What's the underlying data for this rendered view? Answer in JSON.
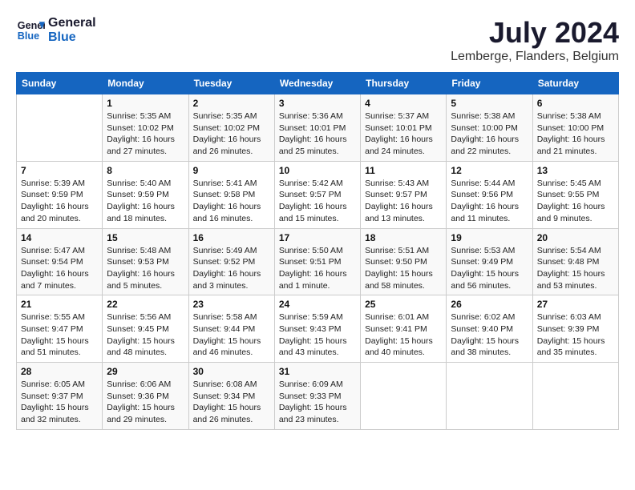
{
  "header": {
    "logo_line1": "General",
    "logo_line2": "Blue",
    "month_year": "July 2024",
    "location": "Lemberge, Flanders, Belgium"
  },
  "weekdays": [
    "Sunday",
    "Monday",
    "Tuesday",
    "Wednesday",
    "Thursday",
    "Friday",
    "Saturday"
  ],
  "weeks": [
    [
      {
        "day": "",
        "info": ""
      },
      {
        "day": "1",
        "info": "Sunrise: 5:35 AM\nSunset: 10:02 PM\nDaylight: 16 hours\nand 27 minutes."
      },
      {
        "day": "2",
        "info": "Sunrise: 5:35 AM\nSunset: 10:02 PM\nDaylight: 16 hours\nand 26 minutes."
      },
      {
        "day": "3",
        "info": "Sunrise: 5:36 AM\nSunset: 10:01 PM\nDaylight: 16 hours\nand 25 minutes."
      },
      {
        "day": "4",
        "info": "Sunrise: 5:37 AM\nSunset: 10:01 PM\nDaylight: 16 hours\nand 24 minutes."
      },
      {
        "day": "5",
        "info": "Sunrise: 5:38 AM\nSunset: 10:00 PM\nDaylight: 16 hours\nand 22 minutes."
      },
      {
        "day": "6",
        "info": "Sunrise: 5:38 AM\nSunset: 10:00 PM\nDaylight: 16 hours\nand 21 minutes."
      }
    ],
    [
      {
        "day": "7",
        "info": "Sunrise: 5:39 AM\nSunset: 9:59 PM\nDaylight: 16 hours\nand 20 minutes."
      },
      {
        "day": "8",
        "info": "Sunrise: 5:40 AM\nSunset: 9:59 PM\nDaylight: 16 hours\nand 18 minutes."
      },
      {
        "day": "9",
        "info": "Sunrise: 5:41 AM\nSunset: 9:58 PM\nDaylight: 16 hours\nand 16 minutes."
      },
      {
        "day": "10",
        "info": "Sunrise: 5:42 AM\nSunset: 9:57 PM\nDaylight: 16 hours\nand 15 minutes."
      },
      {
        "day": "11",
        "info": "Sunrise: 5:43 AM\nSunset: 9:57 PM\nDaylight: 16 hours\nand 13 minutes."
      },
      {
        "day": "12",
        "info": "Sunrise: 5:44 AM\nSunset: 9:56 PM\nDaylight: 16 hours\nand 11 minutes."
      },
      {
        "day": "13",
        "info": "Sunrise: 5:45 AM\nSunset: 9:55 PM\nDaylight: 16 hours\nand 9 minutes."
      }
    ],
    [
      {
        "day": "14",
        "info": "Sunrise: 5:47 AM\nSunset: 9:54 PM\nDaylight: 16 hours\nand 7 minutes."
      },
      {
        "day": "15",
        "info": "Sunrise: 5:48 AM\nSunset: 9:53 PM\nDaylight: 16 hours\nand 5 minutes."
      },
      {
        "day": "16",
        "info": "Sunrise: 5:49 AM\nSunset: 9:52 PM\nDaylight: 16 hours\nand 3 minutes."
      },
      {
        "day": "17",
        "info": "Sunrise: 5:50 AM\nSunset: 9:51 PM\nDaylight: 16 hours\nand 1 minute."
      },
      {
        "day": "18",
        "info": "Sunrise: 5:51 AM\nSunset: 9:50 PM\nDaylight: 15 hours\nand 58 minutes."
      },
      {
        "day": "19",
        "info": "Sunrise: 5:53 AM\nSunset: 9:49 PM\nDaylight: 15 hours\nand 56 minutes."
      },
      {
        "day": "20",
        "info": "Sunrise: 5:54 AM\nSunset: 9:48 PM\nDaylight: 15 hours\nand 53 minutes."
      }
    ],
    [
      {
        "day": "21",
        "info": "Sunrise: 5:55 AM\nSunset: 9:47 PM\nDaylight: 15 hours\nand 51 minutes."
      },
      {
        "day": "22",
        "info": "Sunrise: 5:56 AM\nSunset: 9:45 PM\nDaylight: 15 hours\nand 48 minutes."
      },
      {
        "day": "23",
        "info": "Sunrise: 5:58 AM\nSunset: 9:44 PM\nDaylight: 15 hours\nand 46 minutes."
      },
      {
        "day": "24",
        "info": "Sunrise: 5:59 AM\nSunset: 9:43 PM\nDaylight: 15 hours\nand 43 minutes."
      },
      {
        "day": "25",
        "info": "Sunrise: 6:01 AM\nSunset: 9:41 PM\nDaylight: 15 hours\nand 40 minutes."
      },
      {
        "day": "26",
        "info": "Sunrise: 6:02 AM\nSunset: 9:40 PM\nDaylight: 15 hours\nand 38 minutes."
      },
      {
        "day": "27",
        "info": "Sunrise: 6:03 AM\nSunset: 9:39 PM\nDaylight: 15 hours\nand 35 minutes."
      }
    ],
    [
      {
        "day": "28",
        "info": "Sunrise: 6:05 AM\nSunset: 9:37 PM\nDaylight: 15 hours\nand 32 minutes."
      },
      {
        "day": "29",
        "info": "Sunrise: 6:06 AM\nSunset: 9:36 PM\nDaylight: 15 hours\nand 29 minutes."
      },
      {
        "day": "30",
        "info": "Sunrise: 6:08 AM\nSunset: 9:34 PM\nDaylight: 15 hours\nand 26 minutes."
      },
      {
        "day": "31",
        "info": "Sunrise: 6:09 AM\nSunset: 9:33 PM\nDaylight: 15 hours\nand 23 minutes."
      },
      {
        "day": "",
        "info": ""
      },
      {
        "day": "",
        "info": ""
      },
      {
        "day": "",
        "info": ""
      }
    ]
  ]
}
